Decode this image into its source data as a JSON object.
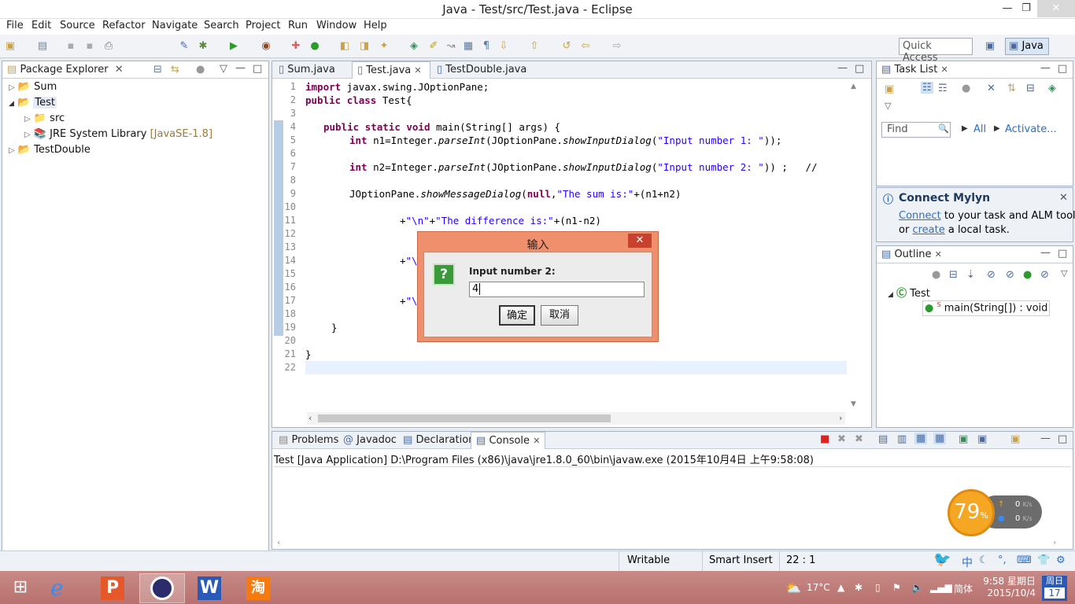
{
  "window": {
    "title": "Java - Test/src/Test.java - Eclipse",
    "minimize": "—",
    "restore": "❐",
    "close": "✕"
  },
  "menu": [
    "File",
    "Edit",
    "Source",
    "Refactor",
    "Navigate",
    "Search",
    "Project",
    "Run",
    "Window",
    "Help"
  ],
  "toolbar": {
    "quick_access_placeholder": "Quick Access",
    "perspective": "Java"
  },
  "package_explorer": {
    "title": "Package Explorer",
    "items": [
      {
        "label": "Sum",
        "expander": "▷"
      },
      {
        "label": "Test",
        "expander": "◢"
      },
      {
        "label": "src",
        "expander": "▷"
      },
      {
        "label": "JRE System Library",
        "suffix": "[JavaSE-1.8]",
        "expander": "▷"
      },
      {
        "label": "TestDouble",
        "expander": "▷"
      }
    ]
  },
  "editor": {
    "tabs": [
      "Sum.java",
      "Test.java",
      "TestDouble.java"
    ],
    "line_numbers": [
      "1",
      "2",
      "3",
      "4",
      "5",
      "6",
      "7",
      "8",
      "9",
      "10",
      "11",
      "12",
      "13",
      "14",
      "15",
      "16",
      "17",
      "18",
      "19",
      "20",
      "21",
      "22"
    ],
    "code": {
      "l1_kw": "import",
      "l1_rest": " javax.swing.JOptionPane;",
      "l2_kw1": "public",
      "l2_kw2": "class",
      "l2_rest": " Test{",
      "l4_kw1": "public",
      "l4_kw2": "static",
      "l4_kw3": "void",
      "l4_rest": " main(String[] args) {",
      "l5_kw": "int",
      "l5_a": " n1=Integer.",
      "l5_it1": "parseInt",
      "l5_b": "(JOptionPane.",
      "l5_it2": "showInputDialog",
      "l5_c": "(",
      "l5_str": "\"Input number 1: \"",
      "l5_d": "));",
      "l7_kw": "int",
      "l7_a": " n2=Integer.",
      "l7_it1": "parseInt",
      "l7_b": "(JOptionPane.",
      "l7_it2": "showInputDialog",
      "l7_c": "(",
      "l7_str": "\"Input number 2: \"",
      "l7_d": ")) ;   //",
      "l9_a": "JOptionPane.",
      "l9_it": "showMessageDialog",
      "l9_b": "(",
      "l9_kw": "null",
      "l9_c": ",",
      "l9_str": "\"The sum is:\"",
      "l9_d": "+(n1+n2)",
      "l11_a": "+",
      "l11_str1": "\"\\n\"",
      "l11_b": "+",
      "l11_str2": "\"The difference is:\"",
      "l11_c": "+(n1-n2)",
      "l14_a": "+",
      "l14_str": "\"\\",
      "l17_a": "+",
      "l17_str": "\"\\",
      "l19": "}",
      "l21": "}"
    }
  },
  "task_list": {
    "title": "Task List",
    "find_placeholder": "Find",
    "all": "All",
    "activate": "Activate..."
  },
  "mylyn": {
    "title": "Connect Mylyn",
    "connect": "Connect",
    "text1": " to your task and ALM tools",
    "or": "or ",
    "create": "create",
    "text2": " a local task."
  },
  "outline": {
    "title": "Outline",
    "class": "Test",
    "method": "main(String[]) : void"
  },
  "console": {
    "tabs": [
      "Problems",
      "Javadoc",
      "Declaration",
      "Console"
    ],
    "header": "Test [Java Application] D:\\Program Files (x86)\\java\\jre1.8.0_60\\bin\\javaw.exe (2015年10月4日 上午9:58:08)"
  },
  "dialog": {
    "title": "输入",
    "prompt": "Input number 2:",
    "value": "4",
    "ok": "确定",
    "cancel": "取消",
    "icon": "?"
  },
  "status": {
    "writable": "Writable",
    "insert_mode": "Smart Insert",
    "position": "22 : 1"
  },
  "net_widget": {
    "percent": "79",
    "percent_sign": "%",
    "up": "0",
    "down": "0",
    "unit": "K/s"
  },
  "taskbar": {
    "weather": "17°C",
    "ime": "简体",
    "time": "9:58 星期日",
    "date": "2015/10/4",
    "calendar_day": "周日",
    "calendar_num": "17",
    "ime_bar": "中"
  },
  "colors": {
    "accent": "#2f6fbf",
    "dialog_border": "#f08f6c",
    "keyword": "#7f0055",
    "string": "#2a00ff"
  }
}
